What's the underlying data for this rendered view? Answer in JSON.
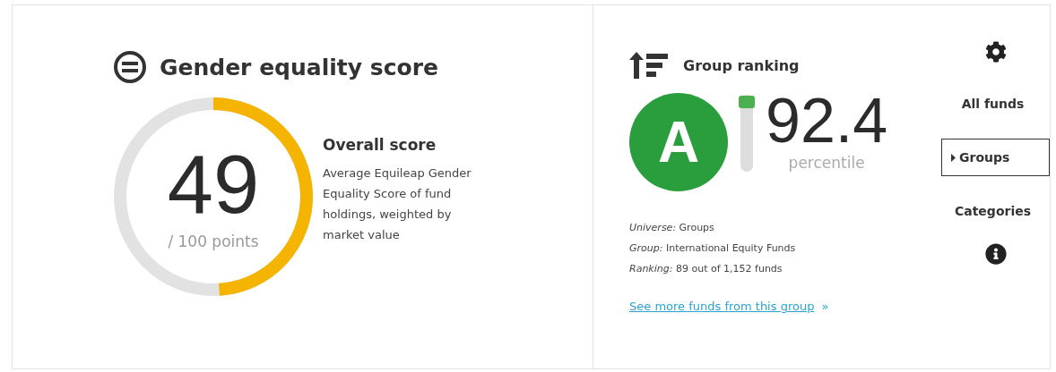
{
  "score_panel": {
    "title": "Gender equality score",
    "score": {
      "value": "49",
      "unit": "/ 100 points",
      "level": 0.49
    },
    "heading": "Overall score",
    "description": "Average Equileap Gender Equality Score of fund holdings, weighted by market value"
  },
  "ranking_panel": {
    "title": "Group ranking",
    "grade": "A",
    "percentile": {
      "value": "92.4",
      "label": "percentile",
      "level": 0.924
    },
    "details": [
      "*Universe:* Groups",
      "*Group:* International Equity Funds",
      "*Ranking:* 89 out of 1,152 funds"
    ],
    "link": {
      "label": "See more funds from this group",
      "arrow": "»"
    }
  },
  "options": [
    {
      "label": "All funds",
      "selected": false
    },
    {
      "label": "Groups",
      "selected": true
    },
    {
      "label": "Categories",
      "selected": false
    }
  ]
}
